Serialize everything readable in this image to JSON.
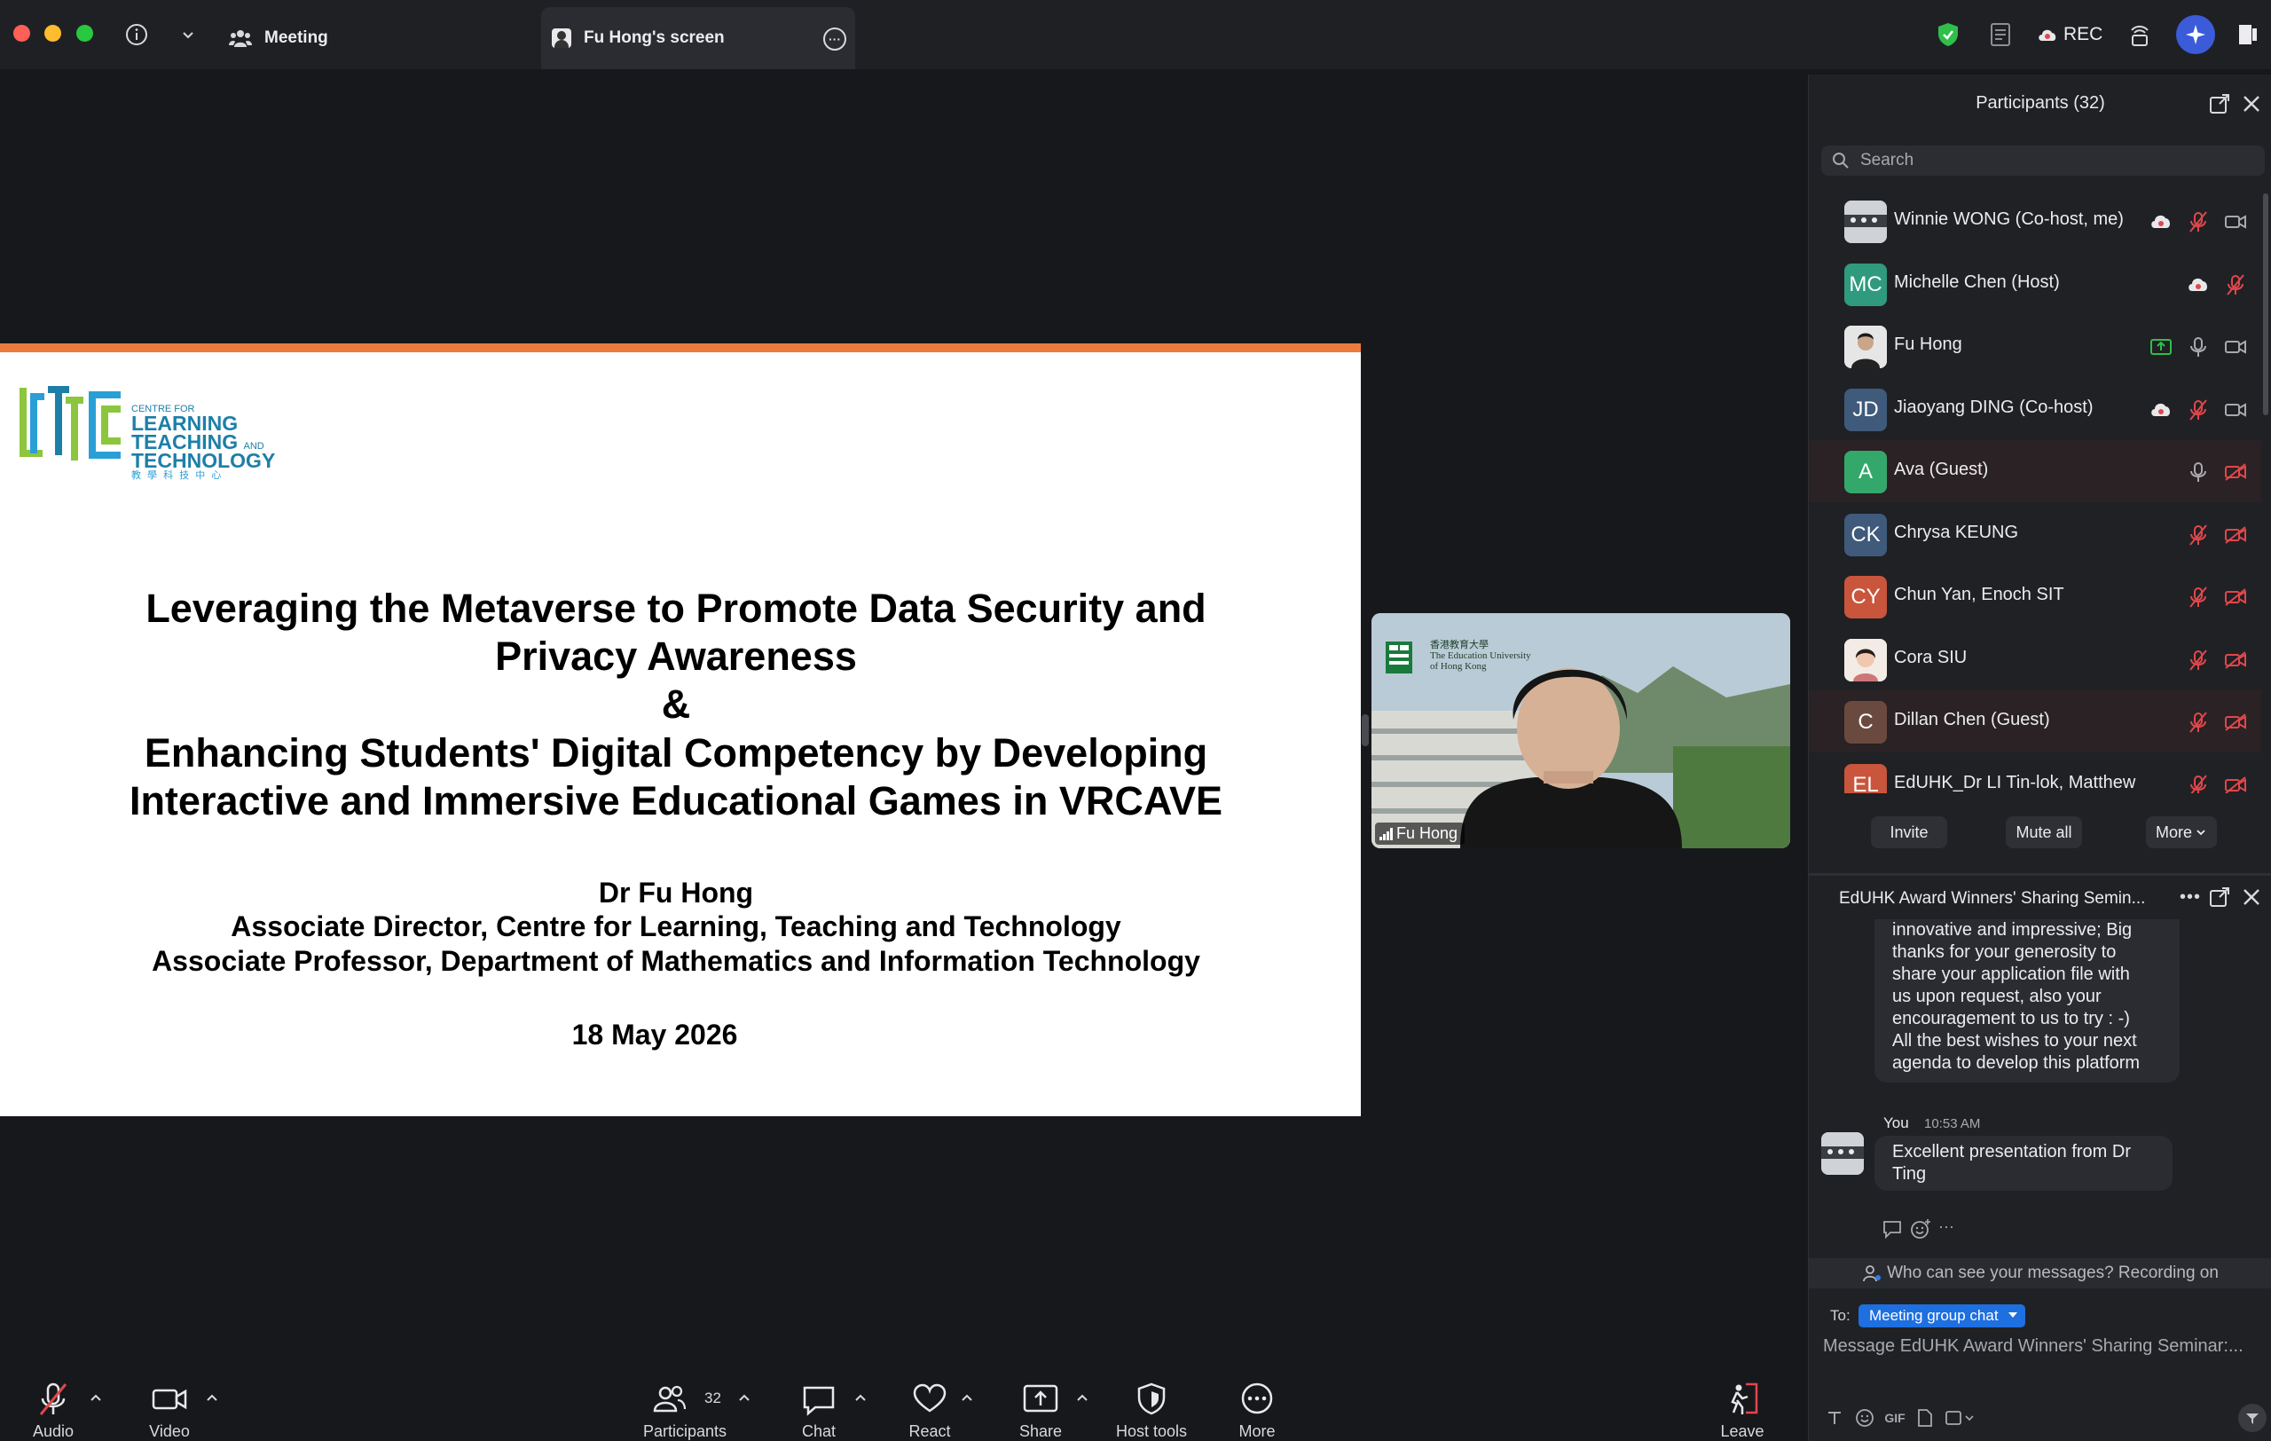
{
  "titlebar": {
    "meeting_tab": "Meeting",
    "share_tab": "Fu Hong's screen",
    "rec_label": "REC"
  },
  "colors": {
    "accent_blue": "#1e6fe0",
    "slide_bar": "#ee7a3b",
    "muted_red": "#e0474b",
    "shield_green": "#2fbf4a"
  },
  "slide": {
    "logo_small": "CENTRE FOR",
    "logo_line1": "LEARNING",
    "logo_line2": "TEACHING",
    "logo_and": "AND",
    "logo_line3": "TECHNOLOGY",
    "logo_chinese": "教 學 科 技 中 心",
    "title_line1": "Leveraging the Metaverse to Promote Data Security and",
    "title_line2": "Privacy Awareness",
    "title_line3": "&",
    "title_line4": "Enhancing Students' Digital Competency by Developing",
    "title_line5": "Interactive and Immersive Educational Games in VRCAVE",
    "presenter": "Dr Fu Hong",
    "role1": "Associate Director, Centre for Learning, Teaching and Technology",
    "role2": "Associate Professor, Department of Mathematics and Information Technology",
    "date": "18 May 2026"
  },
  "video": {
    "name": "Fu Hong",
    "institution_chinese": "香港教育大學",
    "institution_en1": "The Education University",
    "institution_en2": "of Hong Kong"
  },
  "participants": {
    "title": "Participants (32)",
    "search_placeholder": "Search",
    "list": [
      {
        "name": "Winnie WONG (Co-host, me)",
        "initials": "",
        "avatar": "photo",
        "color": "#8a8f98"
      },
      {
        "name": "Michelle Chen (Host)",
        "initials": "MC",
        "avatar": "initials",
        "color": "#2f9a7e"
      },
      {
        "name": "Fu Hong",
        "initials": "",
        "avatar": "photo",
        "color": "#d9d9d9"
      },
      {
        "name": "Jiaoyang DING (Co-host)",
        "initials": "JD",
        "avatar": "initials",
        "color": "#3f5a7a"
      },
      {
        "name": "Ava (Guest)",
        "initials": "A",
        "avatar": "initials",
        "color": "#34a86a"
      },
      {
        "name": "Chrysa KEUNG",
        "initials": "CK",
        "avatar": "initials",
        "color": "#3f5a7a"
      },
      {
        "name": "Chun Yan, Enoch SIT",
        "initials": "CY",
        "avatar": "initials",
        "color": "#c9553c"
      },
      {
        "name": "Cora SIU",
        "initials": "",
        "avatar": "photo",
        "color": "#f0e6df"
      },
      {
        "name": "Dillan Chen (Guest)",
        "initials": "C",
        "avatar": "initials",
        "color": "#6a4a3f"
      },
      {
        "name": "EdUHK_Dr LI Tin-lok, Matthew",
        "initials": "EL",
        "avatar": "initials",
        "color": "#c9553c"
      }
    ],
    "invite": "Invite",
    "mute_all": "Mute all",
    "more": "More"
  },
  "chat": {
    "title": "EdUHK Award Winners' Sharing Semin...",
    "prev_message_lines": [
      "innovative and impressive; Big",
      "thanks for your generosity to",
      "share your application file with",
      "us upon request, also your",
      "encouragement to us to try : -)",
      "All the best wishes to your next",
      "agenda to develop this platform"
    ],
    "my_name": "You",
    "my_time": "10:53 AM",
    "my_message_line1": "Excellent presentation from Dr",
    "my_message_line2": "Ting",
    "privacy": "Who can see your messages? Recording on",
    "to_label": "To:",
    "to_value": "Meeting group chat",
    "input_placeholder": "Message EdUHK Award Winners' Sharing Seminar:...",
    "gif": "GIF"
  },
  "toolbar": {
    "audio": "Audio",
    "video": "Video",
    "participants": "Participants",
    "participants_count": "32",
    "chat": "Chat",
    "react": "React",
    "share": "Share",
    "host_tools": "Host tools",
    "more": "More",
    "leave": "Leave"
  }
}
